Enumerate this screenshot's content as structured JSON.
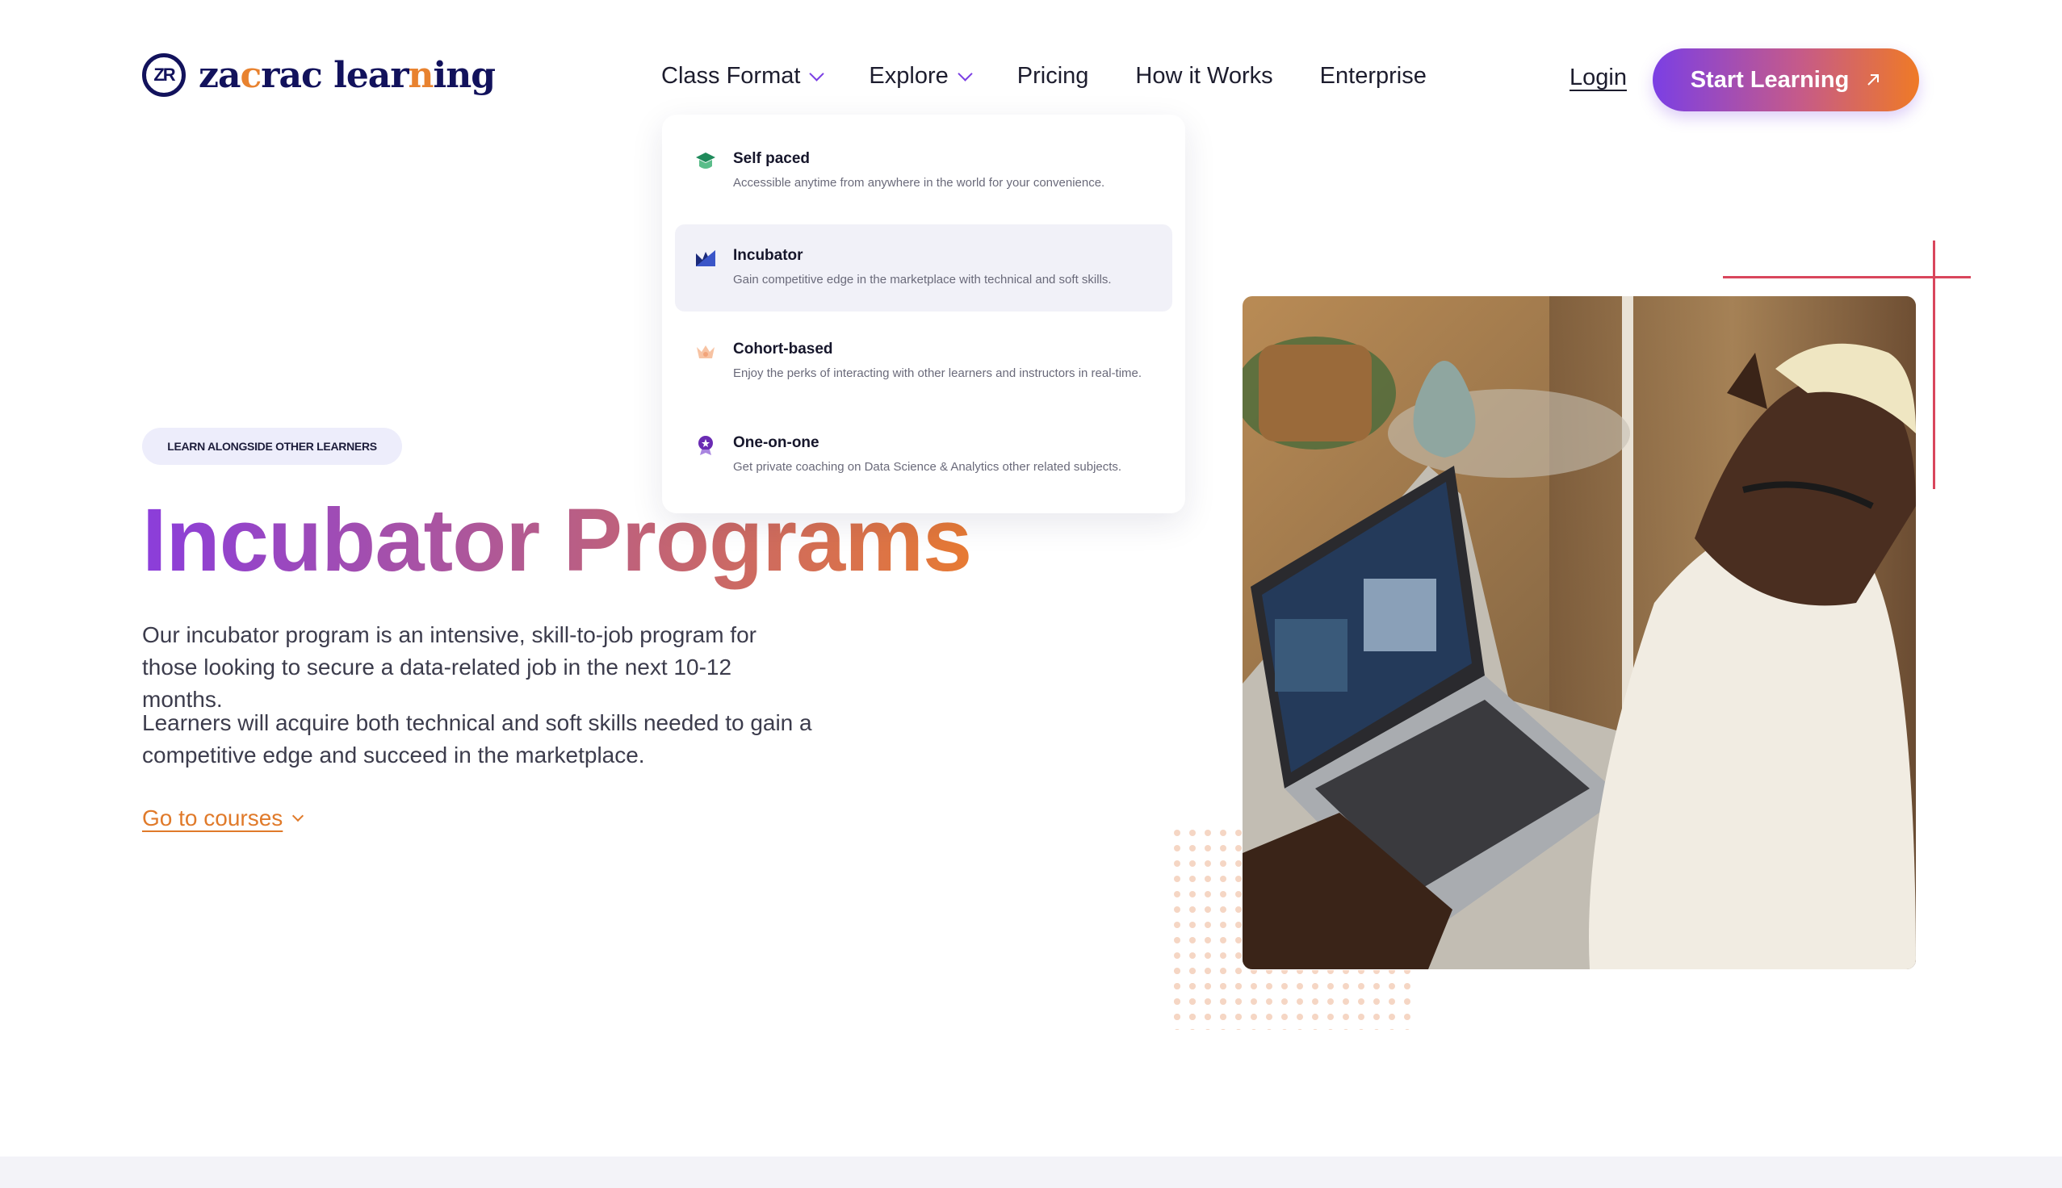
{
  "brand": {
    "mark": "ZR",
    "name_part1": "za",
    "name_accent1": "c",
    "name_part2": "rac lear",
    "name_accent2": "n",
    "name_part3": "ing"
  },
  "nav": {
    "items": [
      {
        "label": "Class Format",
        "has_dropdown": true
      },
      {
        "label": "Explore",
        "has_dropdown": true
      },
      {
        "label": "Pricing",
        "has_dropdown": false
      },
      {
        "label": "How it Works",
        "has_dropdown": false
      },
      {
        "label": "Enterprise",
        "has_dropdown": false
      }
    ],
    "login": "Login",
    "cta": "Start Learning",
    "cta_icon": "arrow-up-right-icon"
  },
  "dropdown": {
    "items": [
      {
        "title": "Self paced",
        "desc": "Accessible anytime from anywhere in the world for your convenience.",
        "icon": "self-paced-icon",
        "color": "#1f8a5b"
      },
      {
        "title": "Incubator",
        "desc": "Gain competitive edge in the marketplace with technical and soft skills.",
        "icon": "incubator-icon",
        "color": "#1b2a7a"
      },
      {
        "title": "Cohort-based",
        "desc": "Enjoy the perks of interacting with other learners and instructors in real-time.",
        "icon": "cohort-icon",
        "color": "#f2a47a"
      },
      {
        "title": "One-on-one",
        "desc": "Get private coaching on Data Science & Analytics other related subjects.",
        "icon": "one-on-one-icon",
        "color": "#6a2bb3"
      }
    ],
    "active_item": "Incubator"
  },
  "hero": {
    "tag": "LEARN ALONGSIDE OTHER LEARNERS",
    "title": "Incubator Programs",
    "paragraph1": "Our incubator program is an intensive, skill-to-job program for those looking to secure a data-related job in the next 10-12 months.",
    "paragraph2": "Learners will acquire both technical and soft skills needed to gain a competitive edge and succeed in the marketplace.",
    "link": "Go to courses"
  },
  "colors": {
    "brand_navy": "#12125c",
    "accent_orange": "#e8822f",
    "accent_purple": "#7b3fe4",
    "deco_red": "#d9465c"
  }
}
